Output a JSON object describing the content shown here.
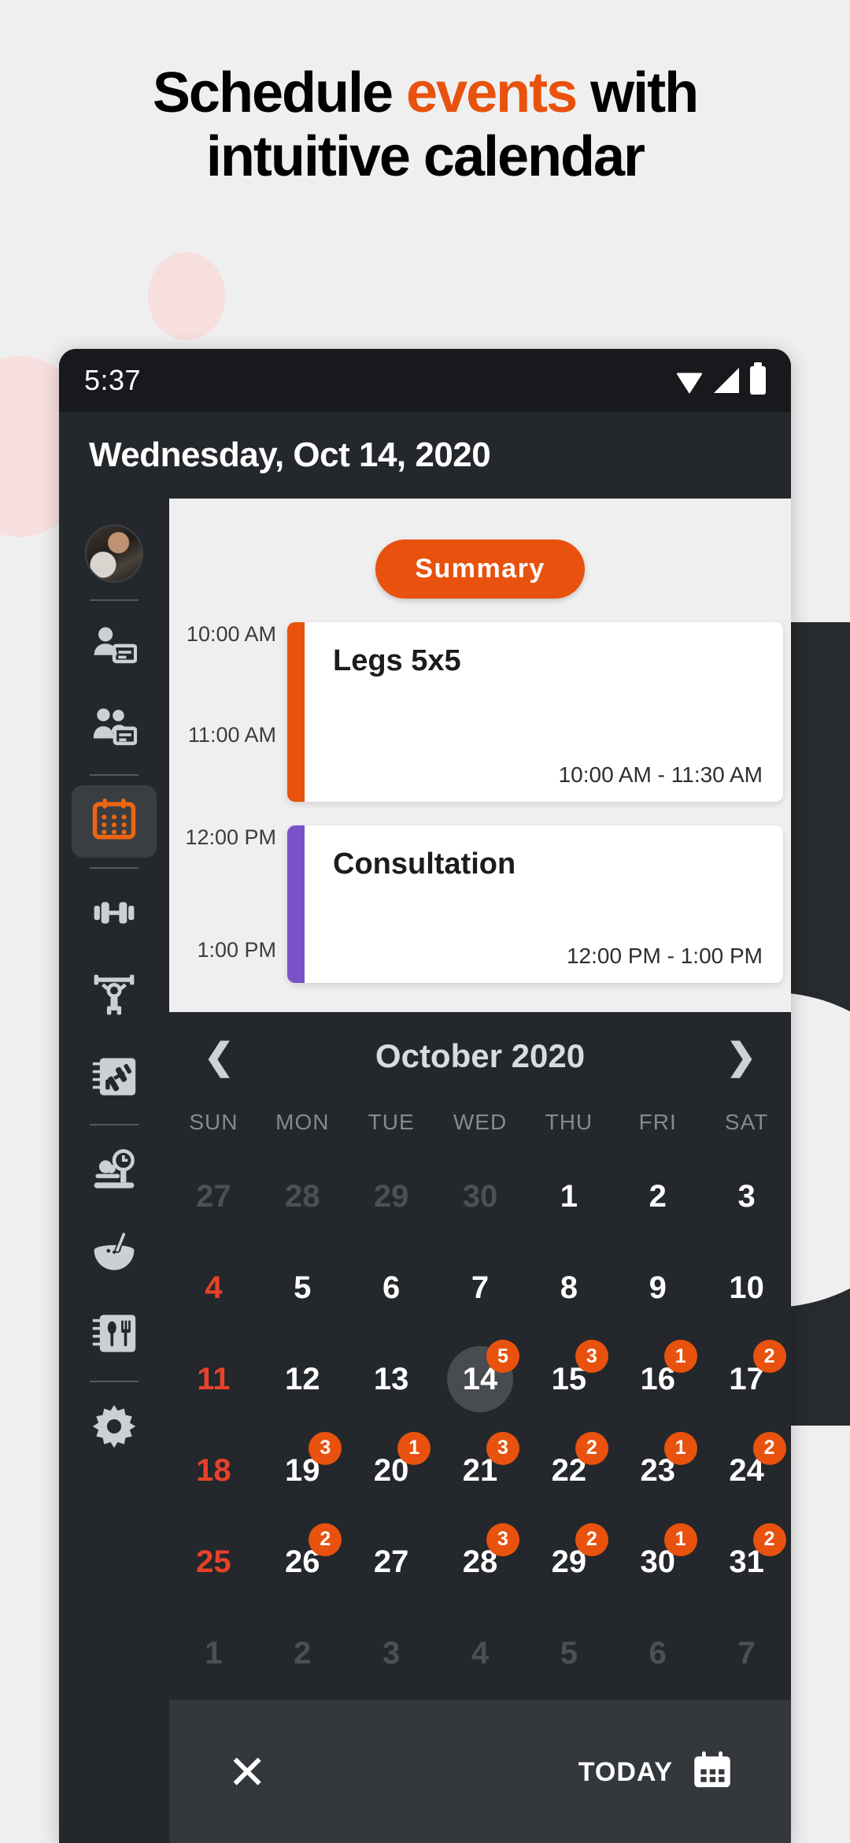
{
  "headline": {
    "line1_pre": "Schedule ",
    "line1_accent": "events",
    "line1_post": " with",
    "line2": "intuitive calendar",
    "accent_color": "#e8520e"
  },
  "status_bar": {
    "time": "5:37",
    "icons": [
      "wifi-icon",
      "signal-icon",
      "battery-icon"
    ]
  },
  "app_header": {
    "title": "Wednesday, Oct 14, 2020"
  },
  "sidebar": {
    "items": [
      {
        "name": "avatar",
        "label": "Profile photo",
        "active": false
      },
      {
        "name": "client-card-icon",
        "label": "Client",
        "active": false
      },
      {
        "name": "group-card-icon",
        "label": "Groups",
        "active": false
      },
      {
        "name": "calendar-icon",
        "label": "Calendar",
        "active": true
      },
      {
        "name": "dumbbell-icon",
        "label": "Exercises",
        "active": false
      },
      {
        "name": "weightlifter-icon",
        "label": "Workouts",
        "active": false
      },
      {
        "name": "workout-plan-icon",
        "label": "Workout plans",
        "active": false
      },
      {
        "name": "food-scale-icon",
        "label": "Nutrition",
        "active": false
      },
      {
        "name": "mixing-bowl-icon",
        "label": "Recipes",
        "active": false
      },
      {
        "name": "meal-plan-icon",
        "label": "Meal plans",
        "active": false
      },
      {
        "name": "gear-icon",
        "label": "Settings",
        "active": false
      }
    ]
  },
  "agenda": {
    "summary_label": "Summary",
    "time_labels": [
      "10:00 AM",
      "11:00 AM",
      "12:00 PM",
      "1:00 PM"
    ],
    "events": [
      {
        "title": "Legs 5x5",
        "time_range": "10:00 AM - 11:30 AM",
        "color": "#e8520e"
      },
      {
        "title": "Consultation",
        "time_range": "12:00 PM - 1:00 PM",
        "color": "#7a52c7"
      }
    ]
  },
  "calendar": {
    "month_label": "October 2020",
    "prev_icon": "chevron-left-icon",
    "next_icon": "chevron-right-icon",
    "day_names": [
      "SUN",
      "MON",
      "TUE",
      "WED",
      "THU",
      "FRI",
      "SAT"
    ],
    "selected_day": 14,
    "weeks": [
      [
        {
          "d": "27",
          "dim": true
        },
        {
          "d": "28",
          "dim": true
        },
        {
          "d": "29",
          "dim": true
        },
        {
          "d": "30",
          "dim": true
        },
        {
          "d": "1"
        },
        {
          "d": "2"
        },
        {
          "d": "3"
        }
      ],
      [
        {
          "d": "4",
          "sun": true
        },
        {
          "d": "5"
        },
        {
          "d": "6"
        },
        {
          "d": "7"
        },
        {
          "d": "8"
        },
        {
          "d": "9"
        },
        {
          "d": "10"
        }
      ],
      [
        {
          "d": "11",
          "sun": true
        },
        {
          "d": "12"
        },
        {
          "d": "13"
        },
        {
          "d": "14",
          "sel": true,
          "badge": "5"
        },
        {
          "d": "15",
          "badge": "3"
        },
        {
          "d": "16",
          "badge": "1"
        },
        {
          "d": "17",
          "badge": "2"
        }
      ],
      [
        {
          "d": "18",
          "sun": true
        },
        {
          "d": "19",
          "badge": "3"
        },
        {
          "d": "20",
          "badge": "1"
        },
        {
          "d": "21",
          "badge": "3"
        },
        {
          "d": "22",
          "badge": "2"
        },
        {
          "d": "23",
          "badge": "1"
        },
        {
          "d": "24",
          "badge": "2"
        }
      ],
      [
        {
          "d": "25",
          "sun": true
        },
        {
          "d": "26",
          "badge": "2"
        },
        {
          "d": "27"
        },
        {
          "d": "28",
          "badge": "3"
        },
        {
          "d": "29",
          "badge": "2"
        },
        {
          "d": "30",
          "badge": "1"
        },
        {
          "d": "31",
          "badge": "2"
        }
      ],
      [
        {
          "d": "1",
          "dim": true
        },
        {
          "d": "2",
          "dim": true
        },
        {
          "d": "3",
          "dim": true
        },
        {
          "d": "4",
          "dim": true
        },
        {
          "d": "5",
          "dim": true
        },
        {
          "d": "6",
          "dim": true
        },
        {
          "d": "7",
          "dim": true
        }
      ]
    ],
    "badge_color": "#e8520e",
    "sunday_color": "#e8412a"
  },
  "bottom_bar": {
    "close_icon": "close-icon",
    "today_label": "TODAY",
    "today_icon": "calendar-icon"
  }
}
